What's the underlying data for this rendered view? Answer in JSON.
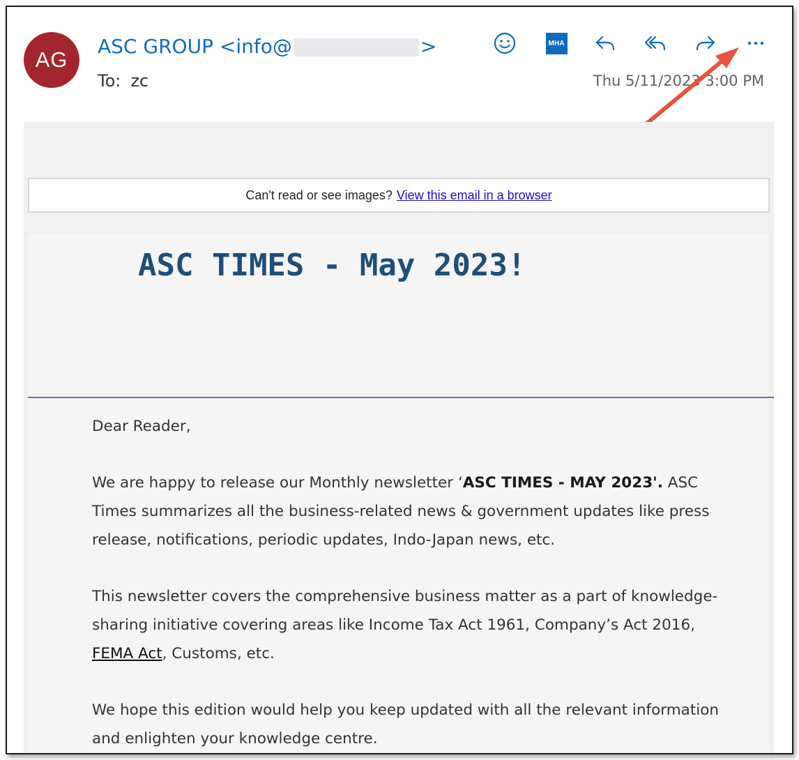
{
  "header": {
    "avatar_initials": "AG",
    "sender_name": "ASC GROUP",
    "sender_email_prefix": "<info@",
    "sender_email_suffix": ">",
    "to_label": "To:",
    "to_value": "zc",
    "date": "Thu 5/11/2023 3:00 PM",
    "avatar_color": "#a4262c",
    "accent_color": "#0f6cbd"
  },
  "toolbar": {
    "icons": [
      "smiley-icon",
      "mha-addin-icon",
      "reply-icon",
      "reply-all-icon",
      "forward-icon",
      "more-options-icon"
    ],
    "mha_label": "MHA"
  },
  "email": {
    "notice_text": "Can't read or see images?",
    "notice_link": "View this email in a browser",
    "title": "ASC TIMES - May 2023!",
    "greeting": "Dear Reader,",
    "p1_pre": "We are happy to release our Monthly newsletter ‘",
    "p1_bold": "ASC TIMES - MAY 2023'.",
    "p1_post": " ASC Times summarizes all the business-related news & government updates like press release, notifications, periodic updates, Indo-Japan news, etc.",
    "p2_pre": "This newsletter covers the comprehensive business matter as a part of knowledge-sharing initiative covering areas like Income Tax Act 1961, Company’s Act 2016, ",
    "p2_link": "FEMA Act",
    "p2_post": ", Customs, etc.",
    "p3": "We hope this edition would help you keep updated with all the relevant information and enlighten your knowledge centre."
  },
  "annotation": {
    "arrow_color": "#e8533f"
  }
}
